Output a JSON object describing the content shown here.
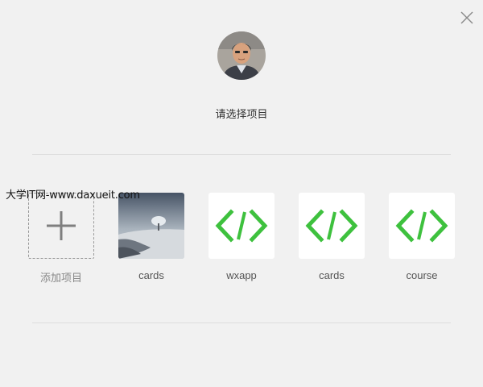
{
  "header": {
    "prompt": "请选择项目"
  },
  "watermark": "大学IT网-www.daxueit.com",
  "add_project": {
    "label": "添加项目",
    "icon": "plus-icon"
  },
  "projects": [
    {
      "name": "cards",
      "icon": "landscape-thumbnail"
    },
    {
      "name": "wxapp",
      "icon": "code-icon"
    },
    {
      "name": "cards",
      "icon": "code-icon"
    },
    {
      "name": "course",
      "icon": "code-icon"
    }
  ],
  "colors": {
    "background": "#f1f1f1",
    "code_icon": "#3ec13e",
    "divider": "#dcdcdc"
  }
}
